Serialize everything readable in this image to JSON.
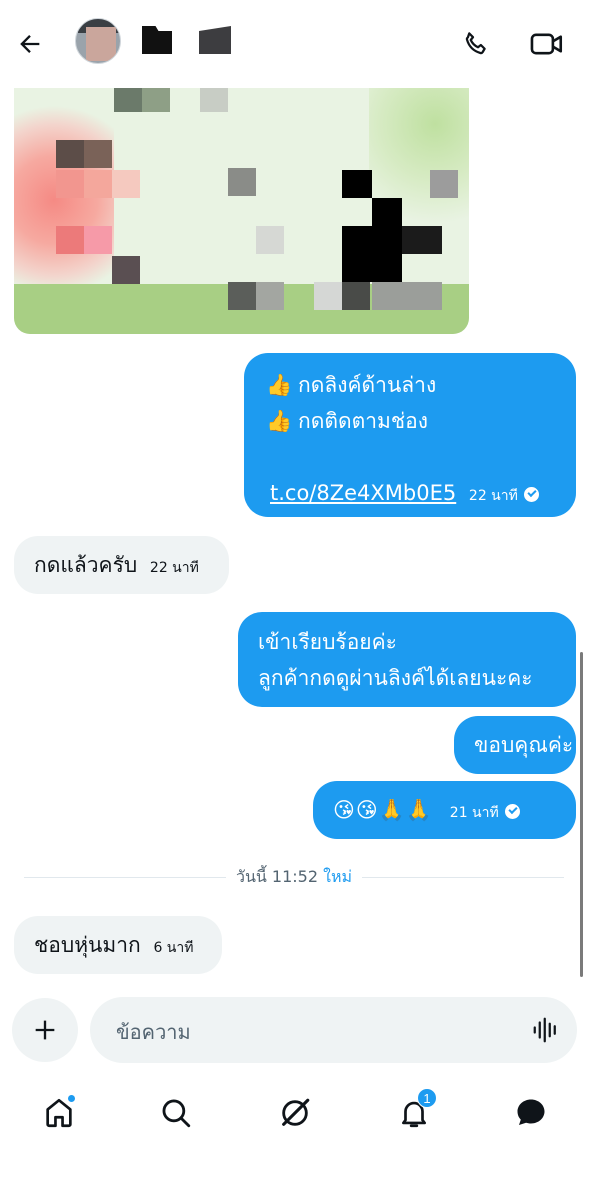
{
  "header": {
    "back_icon": "arrow-left-icon",
    "call_icon": "phone-icon",
    "video_icon": "video-camera-icon"
  },
  "messages": [
    {
      "id": "m1",
      "direction": "outgoing",
      "line1": "กดลิงค์ด้านล่าง",
      "line2": "กดติดตามช่อง",
      "link": "t.co/8Ze4XMb0E5",
      "time": "22 นาที",
      "emoji": "👍"
    },
    {
      "id": "m2",
      "direction": "incoming",
      "text": "กดแล้วครับ",
      "time": "22 นาที"
    },
    {
      "id": "m3",
      "direction": "outgoing",
      "line1": "เข้าเรียบร้อยค่ะ",
      "line2": "ลูกค้ากดดูผ่านลิงค์ได้เลยนะคะ"
    },
    {
      "id": "m4",
      "direction": "outgoing",
      "text": "ขอบคุณค่ะ"
    },
    {
      "id": "m5",
      "direction": "outgoing",
      "text": "😘😘🙏🙏",
      "time": "21 นาที"
    },
    {
      "id": "m6",
      "direction": "incoming",
      "text": "ชอบหุ่นมาก",
      "time": "6 นาที"
    }
  ],
  "divider": {
    "label": "วันนี้ 11:52",
    "new_label": "ใหม่"
  },
  "composer": {
    "placeholder": "ข้อความ",
    "add_icon": "plus-icon",
    "voice_icon": "voice-waveform-icon"
  },
  "nav": {
    "items": [
      {
        "name": "home",
        "icon": "home-icon",
        "has_dot": true
      },
      {
        "name": "search",
        "icon": "search-icon"
      },
      {
        "name": "grok",
        "icon": "grok-icon"
      },
      {
        "name": "notifications",
        "icon": "bell-icon",
        "badge": "1"
      },
      {
        "name": "messages",
        "icon": "message-bubble-icon"
      }
    ]
  },
  "colors": {
    "accent": "#1d9bf0",
    "incoming_bubble": "#eff3f4",
    "text": "#0f1419",
    "muted": "#536471"
  }
}
